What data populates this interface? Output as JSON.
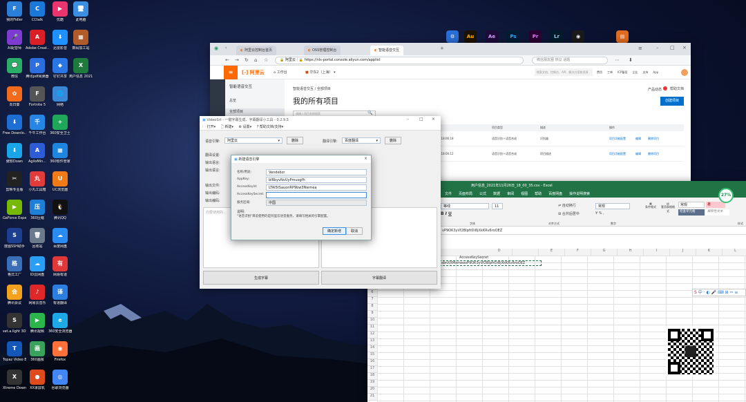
{
  "desktop": {
    "icons": [
      {
        "label": "我的Fidler",
        "color": "#2c7fd6",
        "glyph": "F"
      },
      {
        "label": "CCtalk",
        "color": "#1a78d9",
        "glyph": "C"
      },
      {
        "label": "优酷",
        "color": "#e8356d",
        "glyph": "▶"
      },
      {
        "label": "此电脑",
        "color": "#3b8ee0",
        "glyph": "🖥"
      },
      {
        "label": "AI配音师",
        "color": "#7e3bd0",
        "glyph": "🎤"
      },
      {
        "label": "Adobe Creat...",
        "color": "#da1f26",
        "glyph": "A"
      },
      {
        "label": "迅雷影音",
        "color": "#1e90ff",
        "glyph": "⬇"
      },
      {
        "label": "数码加工站",
        "color": "#b25b2a",
        "glyph": "▦"
      },
      {
        "label": "微信",
        "color": "#2aae67",
        "glyph": "💬"
      },
      {
        "label": "腾讯pdf阅读器",
        "color": "#2a6ee0",
        "glyph": "P"
      },
      {
        "label": "钉钉共享",
        "color": "#2b76e5",
        "glyph": "◆"
      },
      {
        "label": "用户信息 2021年11...",
        "color": "#1f7a3d",
        "glyph": "X"
      },
      {
        "label": "向日葵",
        "color": "#f26b1d",
        "glyph": "✿"
      },
      {
        "label": "Fortnite 5",
        "color": "#555",
        "glyph": "F"
      },
      {
        "label": "网络",
        "color": "#3a87d7",
        "glyph": "🌐"
      },
      {
        "label": "",
        "color": "transparent",
        "glyph": ""
      },
      {
        "label": "Free Downlo...",
        "color": "#1d6fd4",
        "glyph": "⬇"
      },
      {
        "label": "千牛工作台",
        "color": "#2586e6",
        "glyph": "千"
      },
      {
        "label": "360安全卫士",
        "color": "#20a85a",
        "glyph": "+"
      },
      {
        "label": "",
        "color": "transparent",
        "glyph": ""
      },
      {
        "label": "傲软Down",
        "color": "#1aa5e8",
        "glyph": "⬇"
      },
      {
        "label": "AgiloMin...",
        "color": "#2e5bd6",
        "glyph": "A"
      },
      {
        "label": "360软件管家",
        "color": "#1f86e0",
        "glyph": "▦"
      },
      {
        "label": "",
        "color": "transparent",
        "glyph": ""
      },
      {
        "label": "剪映专业版",
        "color": "#222",
        "glyph": "✂"
      },
      {
        "label": "小丸工具箱",
        "color": "#e23b3b",
        "glyph": "丸"
      },
      {
        "label": "UC浏览器",
        "color": "#f07b17",
        "glyph": "U"
      },
      {
        "label": "",
        "color": "transparent",
        "glyph": ""
      },
      {
        "label": "GeForce Experience",
        "color": "#76b900",
        "glyph": "▶"
      },
      {
        "label": "360压缩",
        "color": "#1d7fd8",
        "glyph": "压"
      },
      {
        "label": "腾讯QQ",
        "color": "#111",
        "glyph": "🐧"
      },
      {
        "label": "",
        "color": "transparent",
        "glyph": ""
      },
      {
        "label": "度图SSH助手",
        "color": "#1d3f8f",
        "glyph": "S"
      },
      {
        "label": "回收站",
        "color": "#6a7a8a",
        "glyph": "🗑"
      },
      {
        "label": "百度网盘",
        "color": "#2a8cf0",
        "glyph": "☁"
      },
      {
        "label": "",
        "color": "transparent",
        "glyph": ""
      },
      {
        "label": "格式工厂",
        "color": "#3a6fb8",
        "glyph": "格"
      },
      {
        "label": "ID云网盘",
        "color": "#2a9df4",
        "glyph": "☁"
      },
      {
        "label": "网易有道",
        "color": "#e03838",
        "glyph": "有"
      },
      {
        "label": "",
        "color": "transparent",
        "glyph": ""
      },
      {
        "label": "腾讯会议",
        "color": "#f2a21d",
        "glyph": "会"
      },
      {
        "label": "网易云音乐",
        "color": "#e02727",
        "glyph": "♪"
      },
      {
        "label": "有道翻译",
        "color": "#2a7fe0",
        "glyph": "译"
      },
      {
        "label": "",
        "color": "transparent",
        "glyph": ""
      },
      {
        "label": "set.a.light 3D v2.5",
        "color": "#333",
        "glyph": "S"
      },
      {
        "label": "腾讯视频",
        "color": "#2bb54a",
        "glyph": "▶"
      },
      {
        "label": "360安全浏览器",
        "color": "#1da9e6",
        "glyph": "e"
      },
      {
        "label": "",
        "color": "transparent",
        "glyph": ""
      },
      {
        "label": "Topaz Video En...",
        "color": "#1357b8",
        "glyph": "T"
      },
      {
        "label": "360画报",
        "color": "#3aa35b",
        "glyph": "画"
      },
      {
        "label": "Firefox",
        "color": "#ff7139",
        "glyph": "◉"
      },
      {
        "label": "",
        "color": "transparent",
        "glyph": ""
      },
      {
        "label": "Xtreme Downlo...",
        "color": "#333",
        "glyph": "X"
      },
      {
        "label": "XX录屏机",
        "color": "#e04b1d",
        "glyph": "●"
      },
      {
        "label": "谷歌浏览器",
        "color": "#4285f4",
        "glyph": "◎"
      }
    ]
  },
  "browser": {
    "tabs": [
      "阿里云控制台首页",
      "OSS管理控制台",
      "智能语音交互"
    ],
    "address": "https://nls-portal.console.aliyun.com/applist",
    "address_prefix": "阿里云",
    "search_placeholder": "微信朋友圈 热议 话题",
    "aliyun": {
      "logo": "阿里云",
      "workbench": "工作台",
      "region": "华东2（上海）",
      "search_placeholder": "搜索文档、控制台、API、解决方案和资源",
      "nav": [
        "费用",
        "工单",
        "ICP备案",
        "企业",
        "支持",
        "App"
      ]
    },
    "side_title": "智能语音交互",
    "side_items": [
      "总览",
      "全部项目"
    ],
    "breadcrumb": "智能语音交互 / 全部项目",
    "page_title": "我的所有项目",
    "top_links": [
      "产品动态",
      "帮助文档"
    ],
    "create_button": "创建项目",
    "search_project_placeholder": "请输入项目名称搜索",
    "table_headers": [
      "项目名称",
      "Appkey",
      "创建时间",
      "项目类型",
      "描述",
      "操作"
    ],
    "rows": [
      {
        "time": "2021-11-26 18:06:18",
        "type": "语音识别＋语音合成",
        "desc": "识别器",
        "ops": [
          "项目功能配置",
          "编辑",
          "删除项目"
        ]
      },
      {
        "time": "2021-11-26 18:00:12",
        "type": "语音识别＋语音合成",
        "desc": "项目描述",
        "ops": [
          "项目功能配置",
          "编辑",
          "删除项目"
        ]
      }
    ]
  },
  "videosrt": {
    "title": "VideoSrt - 一键字幕生成、字幕翻译小工具 - 0.2.9.5",
    "menu": [
      "打开",
      "新建",
      "设置",
      "帮助文档/支持"
    ],
    "engine_label": "语音引擎:",
    "engine_value": "阿里云",
    "delete_label": "删除",
    "translate_label": "翻译引擎:",
    "translate_value": "百度翻译",
    "labels": [
      "翻译设置:",
      "输出语言:",
      "输出语言:",
      "输出文件:",
      "输出编码:",
      "输出编码:"
    ],
    "placeholder_text": "向要使用的...",
    "generate_button": "生成字幕",
    "translate_button": "字幕翻译"
  },
  "dialog": {
    "title": "新建语音引擎",
    "fields": [
      {
        "label": "名称/用途:",
        "value": "Vendebzr"
      },
      {
        "label": "AppKey:",
        "value": "blRbyvNvUyPmuogfh"
      },
      {
        "label": "AccessKeyId:",
        "value": "LTAI5tSauonRP9bw3Nwmea"
      },
      {
        "label": "AccessKeySecret:",
        "value": ""
      },
      {
        "label": "服务区域:",
        "value": "中国"
      }
    ],
    "note_label": "说明:",
    "note": "\"语音识别\"目前使用的是阿里云语音服务，请填写相关的引擎配置。",
    "ok": "确定新增",
    "cancel": "取消"
  },
  "excel": {
    "title": "用户信息_2021年11月26日_18_00_35.csv - Excel",
    "menu": [
      "文件",
      "页面布局",
      "公式",
      "数据",
      "审阅",
      "视图",
      "帮助",
      "百度网盘",
      "操作说明搜索"
    ],
    "font": "等线",
    "size": "11",
    "number_format": "常规",
    "groups": [
      "字体",
      "对齐方式",
      "数字",
      "样式"
    ],
    "formula": "vP9OK3yVf2BlpfrDi8jXkKRv6roOEZ",
    "col_headers": [
      "C",
      "D",
      "E",
      "F",
      "G",
      "H",
      "I",
      "J",
      "K",
      "L"
    ],
    "cell_header": "AccessKeySecret",
    "cell_value": "vP9OK3yVf2BlpfrDi8jXkKRv6roOEZ",
    "cell_left": "sbnXXMxmea",
    "styles": [
      "常规",
      "差",
      "适中",
      "好",
      "检查单元格",
      "解释性文本"
    ],
    "badge": "27%"
  }
}
